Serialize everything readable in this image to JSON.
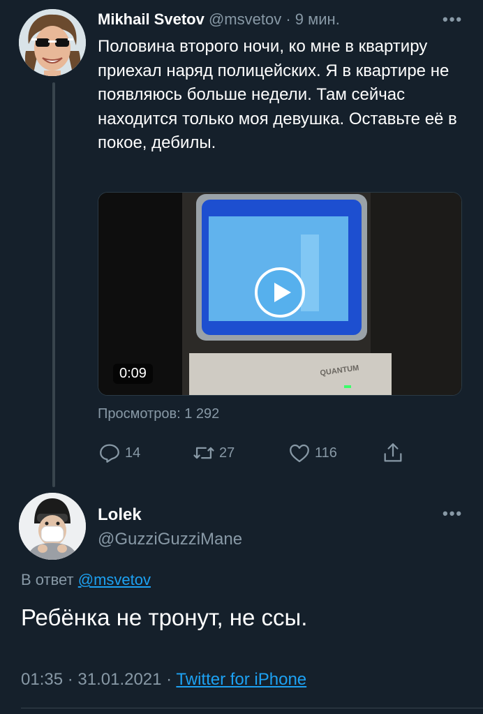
{
  "tweet": {
    "author_name": "Mikhail Svetov",
    "author_handle": "@msvetov",
    "time": "9 мин.",
    "text": "Половина второго ночи, ко мне в квартиру приехал наряд полицейских. Я в квартире не появляюсь больше недели. Там сейчас находится только моя девушка. Оставьте её в покое, дебилы.",
    "video": {
      "duration": "0:09",
      "brand_text": "QUANTUM"
    },
    "views": "Просмотров: 1 292",
    "actions": {
      "replies": "14",
      "retweets": "27",
      "likes": "116"
    }
  },
  "reply": {
    "author_name": "Lolek",
    "author_handle": "@GuzziGuzziMane",
    "reply_prefix": "В ответ",
    "reply_to_handle": "@msvetov",
    "text": "Ребёнка не тронут, не ссы.",
    "timestamp": "01:35 · 31.01.2021 ·",
    "source": "Twitter for iPhone"
  },
  "colors": {
    "background": "#15202b",
    "secondary_text": "#8899a6",
    "link": "#1da1f2"
  },
  "icons": [
    "more-icon",
    "play-icon",
    "reply-icon",
    "retweet-icon",
    "like-icon",
    "share-icon"
  ]
}
